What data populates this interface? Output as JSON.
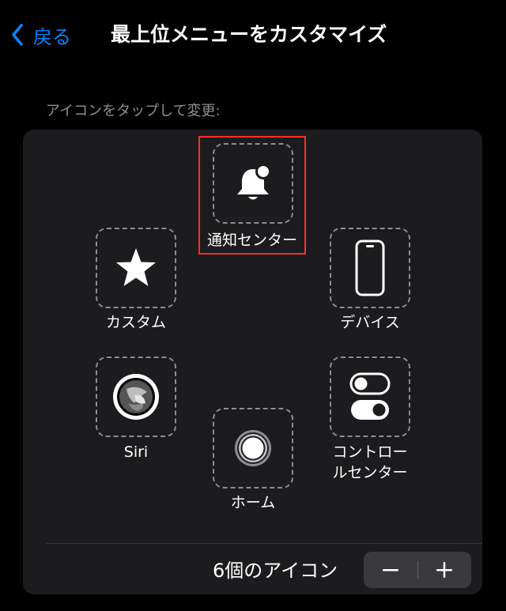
{
  "nav": {
    "back_label": "戻る",
    "title": "最上位メニューをカスタマイズ"
  },
  "hint": "アイコンをタップして変更:",
  "slots": {
    "notification_center": {
      "label": "通知センター",
      "icon": "bell-badge-icon"
    },
    "custom": {
      "label": "カスタム",
      "icon": "star-icon"
    },
    "device": {
      "label": "デバイス",
      "icon": "iphone-icon"
    },
    "siri": {
      "label": "Siri",
      "icon": "siri-icon"
    },
    "home": {
      "label": "ホーム",
      "icon": "home-button-icon"
    },
    "control_center": {
      "label_line1": "コントロー",
      "label_line2": "ルセンター",
      "icon": "toggles-icon"
    }
  },
  "footer": {
    "icon_count_label": "6個のアイコン",
    "decrement": "minus-icon",
    "increment": "plus-icon"
  },
  "colors": {
    "accent": "#0a84ff",
    "background": "#000000",
    "panel": "#1c1c1e",
    "highlight": "#ff2d2d"
  }
}
